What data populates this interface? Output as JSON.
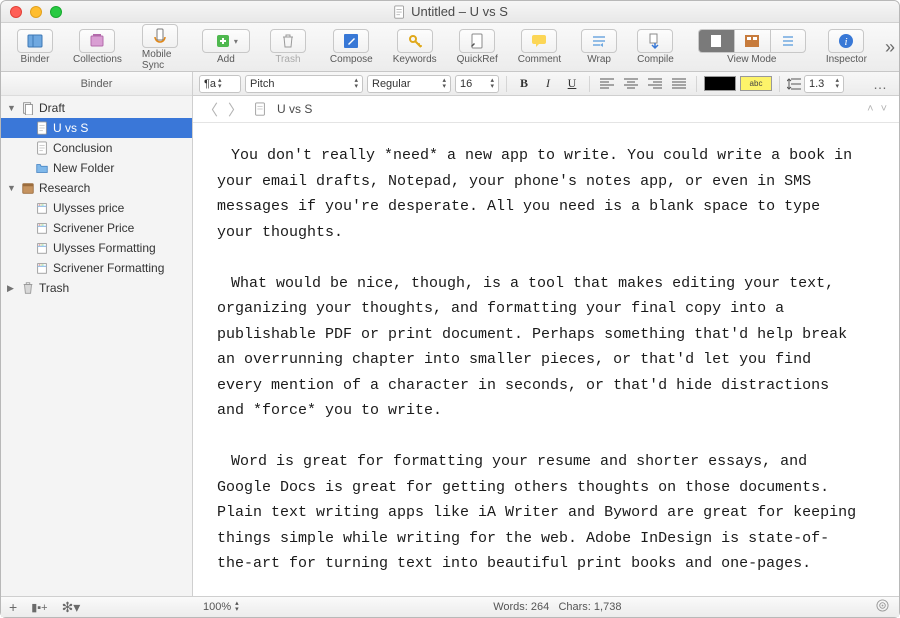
{
  "window": {
    "title": "Untitled – U vs S"
  },
  "toolbar": {
    "binder": "Binder",
    "collections": "Collections",
    "mobilesync": "Mobile Sync",
    "add": "Add",
    "trash": "Trash",
    "compose": "Compose",
    "keywords": "Keywords",
    "quickref": "QuickRef",
    "comment": "Comment",
    "wrap": "Wrap",
    "compile": "Compile",
    "viewmode": "View Mode",
    "inspector": "Inspector"
  },
  "sidebar": {
    "header": "Binder",
    "items": [
      {
        "label": "Draft",
        "type": "draft",
        "depth": 0,
        "expanded": true
      },
      {
        "label": "U vs S",
        "type": "doc",
        "depth": 1,
        "selected": true
      },
      {
        "label": "Conclusion",
        "type": "doc",
        "depth": 1
      },
      {
        "label": "New Folder",
        "type": "folder",
        "depth": 1
      },
      {
        "label": "Research",
        "type": "research",
        "depth": 0,
        "expanded": true
      },
      {
        "label": "Ulysses price",
        "type": "clip",
        "depth": 1
      },
      {
        "label": "Scrivener Price",
        "type": "clip",
        "depth": 1
      },
      {
        "label": "Ulysses Formatting",
        "type": "clip",
        "depth": 1
      },
      {
        "label": "Scrivener Formatting",
        "type": "clip",
        "depth": 1
      },
      {
        "label": "Trash",
        "type": "trash",
        "depth": 0,
        "expanded": false
      }
    ]
  },
  "formatbar": {
    "paragraph_icon": "¶a",
    "font": "Pitch",
    "weight": "Regular",
    "size": "16",
    "bold": "B",
    "italic": "I",
    "underline": "U",
    "highlight_text": "abc",
    "linespacing": "1.3"
  },
  "crumb": {
    "title": "U vs S"
  },
  "document": {
    "paragraphs": [
      "You don't really *need* a new app to write. You could write a book in your email drafts, Notepad, your phone's notes app, or even in SMS messages if you're desperate. All you need is a blank space to type your thoughts.",
      "",
      "What would be nice, though, is a tool that makes editing your text, organizing your thoughts, and formatting your final copy into a publishable PDF or print document. Perhaps something that'd help break an overrunning chapter into smaller pieces, or that'd let you find every mention of a character in seconds, or that'd hide distractions and *force* you to write.",
      "",
      "Word is great for formatting your resume and shorter essays, and Google Docs is great for getting others thoughts on those documents. Plain text writing apps like iA Writer and Byword are great for keeping things simple while writing for the web. Adobe InDesign is state-of-the-art for turning text into beautiful print books and one-pages."
    ]
  },
  "status": {
    "zoom": "100%",
    "words_label": "Words:",
    "words": "264",
    "chars_label": "Chars:",
    "chars": "1,738"
  }
}
